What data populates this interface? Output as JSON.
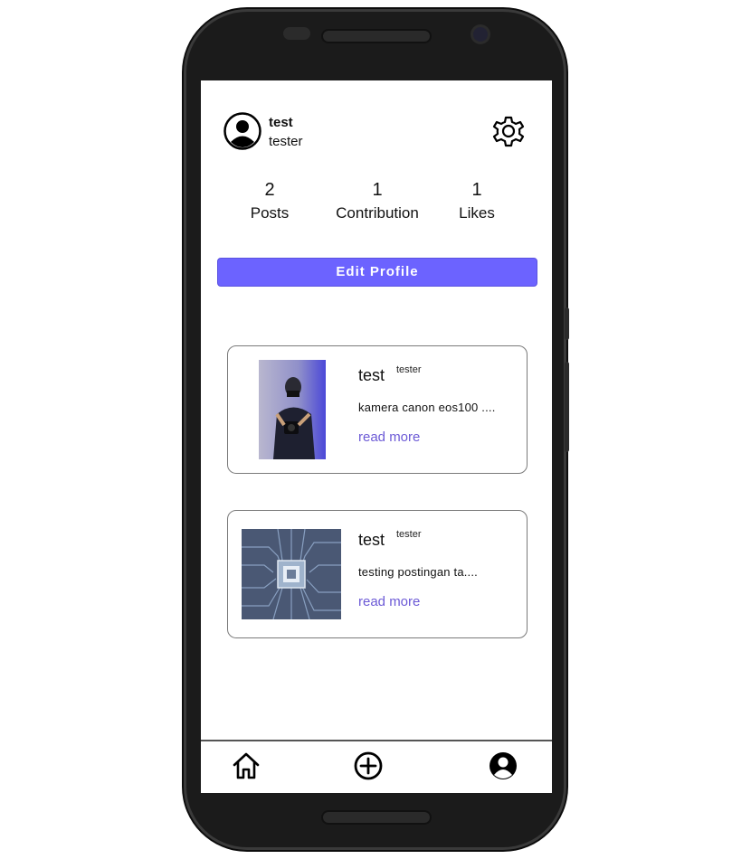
{
  "profile": {
    "name": "test",
    "handle": "tester"
  },
  "stats": [
    {
      "value": "2",
      "label": "Posts"
    },
    {
      "value": "1",
      "label": "Contribution"
    },
    {
      "value": "1",
      "label": "Likes"
    }
  ],
  "edit_profile_label": "Edit Profile",
  "posts": [
    {
      "title": "test",
      "user": "tester",
      "excerpt": "kamera canon eos100 ....",
      "read_more": "read more"
    },
    {
      "title": "test",
      "user": "tester",
      "excerpt": "testing postingan ta....",
      "read_more": "read more"
    }
  ],
  "icons": {
    "settings": "gear-icon",
    "avatar": "user-avatar-icon",
    "nav_home": "home-icon",
    "nav_add": "plus-circle-icon",
    "nav_profile": "profile-icon"
  },
  "colors": {
    "accent": "#6c63ff",
    "link": "#6c5ad6",
    "frame": "#1b1b1b"
  }
}
